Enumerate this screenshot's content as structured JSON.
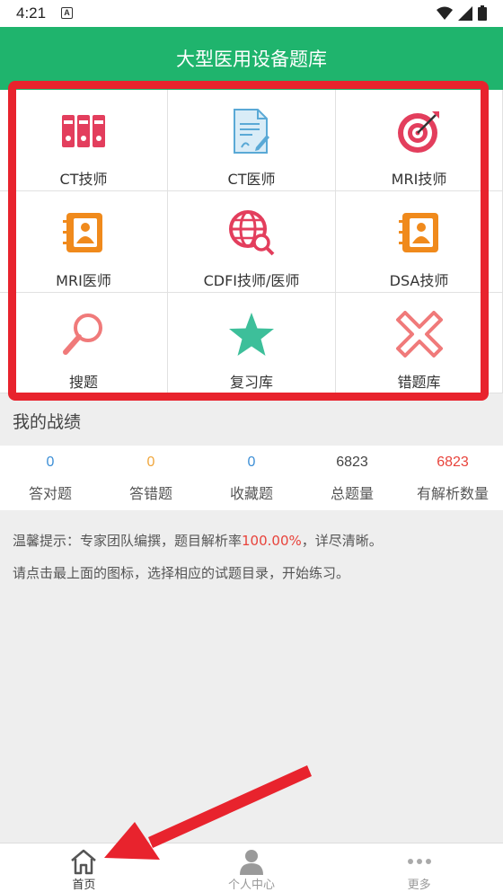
{
  "status": {
    "time": "4:21",
    "notif_badge": "A"
  },
  "header": {
    "title": "大型医用设备题库"
  },
  "grid": [
    {
      "label": "CT技师",
      "icon": "binders-icon"
    },
    {
      "label": "CT医师",
      "icon": "document-pen-icon"
    },
    {
      "label": "MRI技师",
      "icon": "target-icon"
    },
    {
      "label": "MRI医师",
      "icon": "contact-book-icon"
    },
    {
      "label": "CDFI技师/医师",
      "icon": "globe-search-icon"
    },
    {
      "label": "DSA技师",
      "icon": "contact-book-icon"
    },
    {
      "label": "搜题",
      "icon": "magnifier-icon"
    },
    {
      "label": "复习库",
      "icon": "star-icon"
    },
    {
      "label": "错题库",
      "icon": "cross-icon"
    }
  ],
  "stats": {
    "title": "我的战绩",
    "items": [
      {
        "value": "0",
        "label": "答对题",
        "color": "#3d8fd6"
      },
      {
        "value": "0",
        "label": "答错题",
        "color": "#f0a63c"
      },
      {
        "value": "0",
        "label": "收藏题",
        "color": "#3d8fd6"
      },
      {
        "value": "6823",
        "label": "总题量",
        "color": "#444444"
      },
      {
        "value": "6823",
        "label": "有解析数量",
        "color": "#e8433b"
      }
    ]
  },
  "tips": {
    "line1_prefix": "温馨提示：专家团队编撰，题目解析率",
    "line1_pct": "100.00%",
    "line1_suffix": "，详尽清晰。",
    "line2": "请点击最上面的图标，选择相应的试题目录，开始练习。"
  },
  "tabs": [
    {
      "label": "首页",
      "icon": "home-icon",
      "active": true
    },
    {
      "label": "个人中心",
      "icon": "person-icon",
      "active": false
    },
    {
      "label": "更多",
      "icon": "more-icon",
      "active": false
    }
  ],
  "colors": {
    "accent": "#1fb46d",
    "highlight": "#e8232d"
  }
}
